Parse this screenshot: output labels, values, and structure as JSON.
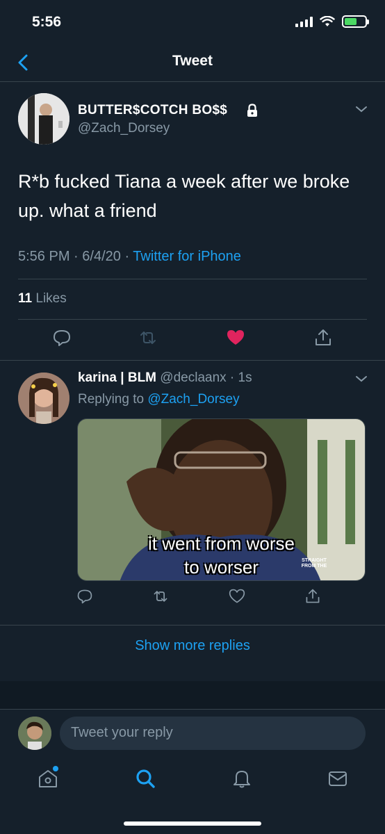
{
  "status_bar": {
    "time": "5:56"
  },
  "nav": {
    "title": "Tweet"
  },
  "tweet": {
    "author_name": "BUTTER$COTCH BO$$",
    "author_handle": "@Zach_Dorsey",
    "text": "R*b fucked Tiana a week after we broke up. what a friend",
    "time": "5:56 PM",
    "date": "6/4/20",
    "source": "Twitter for iPhone",
    "likes_count": "11",
    "likes_label": "Likes",
    "liked": true
  },
  "reply": {
    "author_name": "karina | BLM",
    "author_handle": "@declaanx",
    "age": "1s",
    "replying_label": "Replying to",
    "replying_to": "@Zach_Dorsey",
    "media_caption_line1": "it went from worse",
    "media_caption_line2": "to worser",
    "media_watermark": "STRAIGHT FROM THE"
  },
  "show_more": "Show more replies",
  "compose": {
    "placeholder": "Tweet your reply"
  },
  "colors": {
    "background": "#15202b",
    "accent": "#1da1f2",
    "like": "#e0245e",
    "secondary_text": "#8899a6"
  },
  "icons": [
    "back-chevron-icon",
    "lock-icon",
    "chevron-down-icon",
    "reply-icon",
    "retweet-icon",
    "heart-icon",
    "share-icon",
    "home-icon",
    "search-icon",
    "bell-icon",
    "mail-icon"
  ]
}
